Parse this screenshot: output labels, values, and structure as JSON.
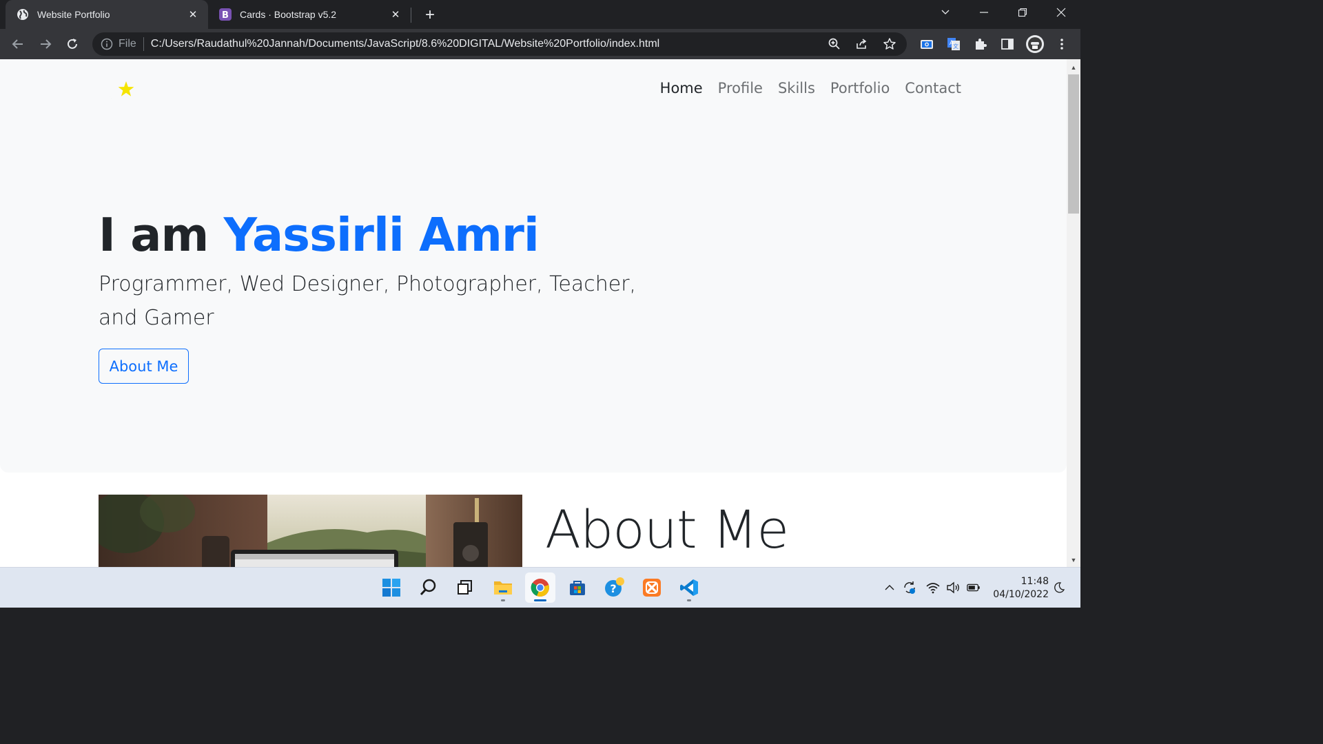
{
  "browser": {
    "tabs": [
      {
        "title": "Website Portfolio",
        "active": true
      },
      {
        "title": "Cards · Bootstrap v5.2",
        "active": false
      }
    ],
    "omnibox": {
      "scheme_label": "File",
      "url": "C:/Users/Raudathul%20Jannah/Documents/JavaScript/8.6%20DIGITAL/Website%20Portfolio/index.html"
    }
  },
  "page": {
    "nav": {
      "links": [
        {
          "label": "Home",
          "active": true
        },
        {
          "label": "Profile",
          "active": false
        },
        {
          "label": "Skills",
          "active": false
        },
        {
          "label": "Portfolio",
          "active": false
        },
        {
          "label": "Contact",
          "active": false
        }
      ]
    },
    "hero": {
      "title_prefix": "I am",
      "title_name": "Yassirli Amri",
      "subtitle": "Programmer, Wed Designer, Photographer, Teacher, and Gamer",
      "button_label": "About Me"
    },
    "about": {
      "heading": "About Me"
    }
  },
  "taskbar": {
    "time": "11:48",
    "date": "04/10/2022"
  },
  "colors": {
    "accent": "#0d6efd",
    "logo_green": "#0a9b42",
    "logo_star": "#f5e400"
  }
}
